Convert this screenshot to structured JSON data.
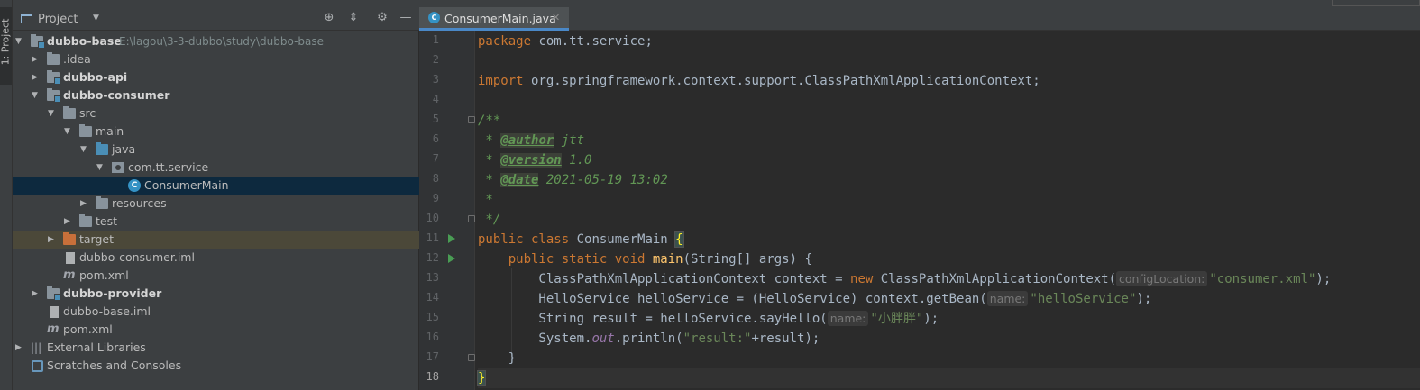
{
  "side_strip": {
    "tab_label": "1: Project"
  },
  "project_panel": {
    "title": "Project",
    "tree": [
      {
        "label": "dubbo-base",
        "path": "E:\\lagou\\3-3-dubbo\\study\\dubbo-base"
      },
      {
        "label": ".idea"
      },
      {
        "label": "dubbo-api"
      },
      {
        "label": "dubbo-consumer"
      },
      {
        "label": "src"
      },
      {
        "label": "main"
      },
      {
        "label": "java"
      },
      {
        "label": "com.tt.service"
      },
      {
        "label": "ConsumerMain"
      },
      {
        "label": "resources"
      },
      {
        "label": "test"
      },
      {
        "label": "target"
      },
      {
        "label": "dubbo-consumer.iml"
      },
      {
        "label": "pom.xml"
      },
      {
        "label": "dubbo-provider"
      },
      {
        "label": "dubbo-base.iml"
      },
      {
        "label": "pom.xml"
      },
      {
        "label": "External Libraries"
      },
      {
        "label": "Scratches and Consoles"
      }
    ]
  },
  "editor": {
    "tab_label": "ConsumerMain.java",
    "line_numbers": [
      "1",
      "2",
      "3",
      "4",
      "5",
      "6",
      "7",
      "8",
      "9",
      "10",
      "11",
      "12",
      "13",
      "14",
      "15",
      "16",
      "17",
      "18"
    ],
    "code": {
      "l1_kw": "package",
      "l1_rest": " com.tt.service;",
      "l3_kw": "import",
      "l3_rest": " org.springframework.context.support.ClassPathXmlApplicationContext;",
      "l5": "/**",
      "l6_star": " * ",
      "l6_tag": "@author",
      "l6_val": " jtt",
      "l7_star": " * ",
      "l7_tag": "@version",
      "l7_val": " 1.0",
      "l8_star": " * ",
      "l8_tag": "@date",
      "l8_val": " 2021-05-19 13:02",
      "l9": " *",
      "l10": " */",
      "l11_kw": "public class",
      "l11_name": " ConsumerMain ",
      "l11_brace": "{",
      "l12_indent": "    ",
      "l12_kw": "public static void",
      "l12_fn": "main",
      "l12_rest": "(String[] args) {",
      "l13_a": "        ClassPathXmlApplicationContext context = ",
      "l13_kw": "new",
      "l13_b": " ClassPathXmlApplicationContext(",
      "l13_hint": "configLocation:",
      "l13_str": "\"consumer.xml\"",
      "l13_end": ");",
      "l14_a": "        HelloService helloService = (HelloService) context.getBean(",
      "l14_hint": "name:",
      "l14_str": "\"helloService\"",
      "l14_end": ");",
      "l15_a": "        String result = helloService.sayHello(",
      "l15_hint": "name:",
      "l15_str": "\"小胖胖\"",
      "l15_end": ");",
      "l16_a": "        System.",
      "l16_out": "out",
      "l16_b": ".println(",
      "l16_str": "\"result:\"",
      "l16_end": "+result);",
      "l17": "    }",
      "l18": "}"
    }
  },
  "colors": {
    "keyword": "#cc7832",
    "string": "#6a8759",
    "doc_comment": "#629755",
    "function": "#ffc66d",
    "selection": "#0d293e"
  }
}
